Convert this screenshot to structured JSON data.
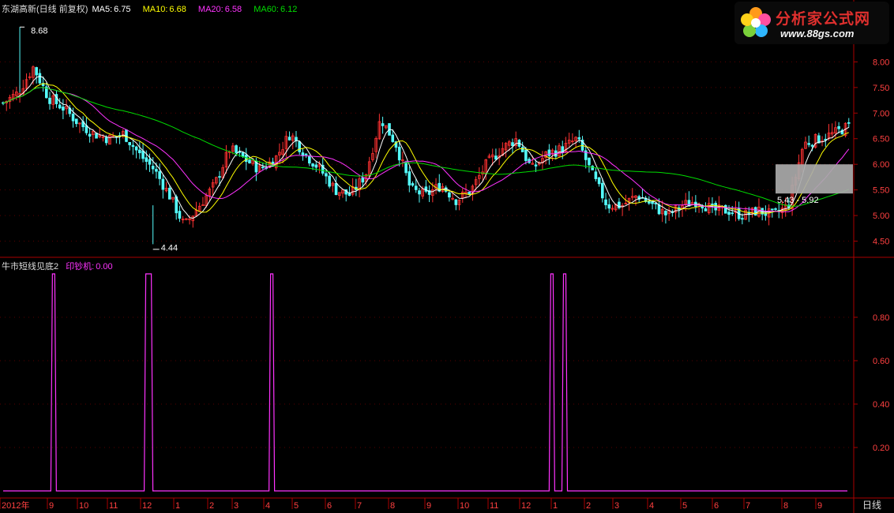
{
  "price_panel": {
    "title": "东湖高新(日线 前复权)",
    "ma": [
      {
        "label": "MA5:",
        "value": "6.75",
        "color": "#ffffff"
      },
      {
        "label": "MA10:",
        "value": "6.68",
        "color": "#ffff00"
      },
      {
        "label": "MA20:",
        "value": "6.58",
        "color": "#ff33ff"
      },
      {
        "label": "MA60:",
        "value": "6.12",
        "color": "#00dd00"
      }
    ],
    "high_label": "8.68",
    "low_label": "4.44",
    "range_label": "5.43 - 5.92"
  },
  "indicator_panel": {
    "name": "牛市短线见底2",
    "series_label": "印钞机:",
    "series_value": "0.00",
    "name_color": "#dddddd",
    "series_color": "#ff33ff"
  },
  "footer": {
    "period": "日线"
  },
  "logo": {
    "brand": "分析家公式网",
    "url": "www.88gs.com"
  },
  "colors": {
    "up": "#ff3232",
    "down": "#54fcfc",
    "ma5": "#ffffff",
    "ma10": "#ffff00",
    "ma20": "#ff33ff",
    "ma60": "#00dd00",
    "border": "#aa0000",
    "axis_text": "#ff4040"
  },
  "chart_data": [
    {
      "type": "candlestick",
      "title": "东湖高新(日线 前复权)",
      "ylim": [
        4.2,
        8.9
      ],
      "yticks": [
        "8.00",
        "7.50",
        "7.00",
        "6.50",
        "6.00",
        "5.50",
        "5.00",
        "4.50"
      ],
      "x_labels": [
        "2012年",
        "9",
        "10",
        "11",
        "12",
        "1",
        "2",
        "3",
        "4",
        "5",
        "6",
        "7",
        "8",
        "9",
        "10",
        "11",
        "12",
        "1",
        "2",
        "3",
        "4",
        "5",
        "6",
        "7",
        "8",
        "9"
      ],
      "close_trend": [
        7.2,
        7.4,
        7.9,
        7.3,
        7.1,
        6.8,
        6.6,
        6.5,
        6.6,
        6.2,
        5.9,
        5.4,
        4.8,
        5.2,
        5.6,
        6.3,
        6.1,
        5.9,
        6.1,
        6.6,
        6.2,
        5.9,
        5.5,
        5.4,
        5.8,
        6.9,
        6.4,
        5.5,
        5.4,
        5.6,
        5.3,
        5.5,
        6.0,
        6.3,
        6.5,
        5.9,
        6.2,
        6.3,
        6.5,
        5.8,
        5.2,
        5.2,
        5.4,
        5.2,
        5.0,
        5.2,
        5.3,
        5.1,
        5.1,
        5.0,
        5.1,
        5.0,
        5.2,
        6.4,
        6.5,
        6.6,
        6.75
      ],
      "extremes": {
        "high": 8.68,
        "low": 4.44
      },
      "shaded_range": [
        5.43,
        5.92
      ],
      "ma_current": {
        "MA5": 6.75,
        "MA10": 6.68,
        "MA20": 6.58,
        "MA60": 6.12
      }
    },
    {
      "type": "line",
      "title": "牛市短线见底2",
      "series": [
        {
          "name": "印钞机",
          "signal_positions": [
            0.058,
            0.168,
            0.315,
            0.645,
            0.66
          ]
        }
      ],
      "ylim": [
        0,
        1
      ],
      "yticks": [
        "0.80",
        "0.60",
        "0.40",
        "0.20"
      ],
      "current_value": 0.0
    }
  ]
}
